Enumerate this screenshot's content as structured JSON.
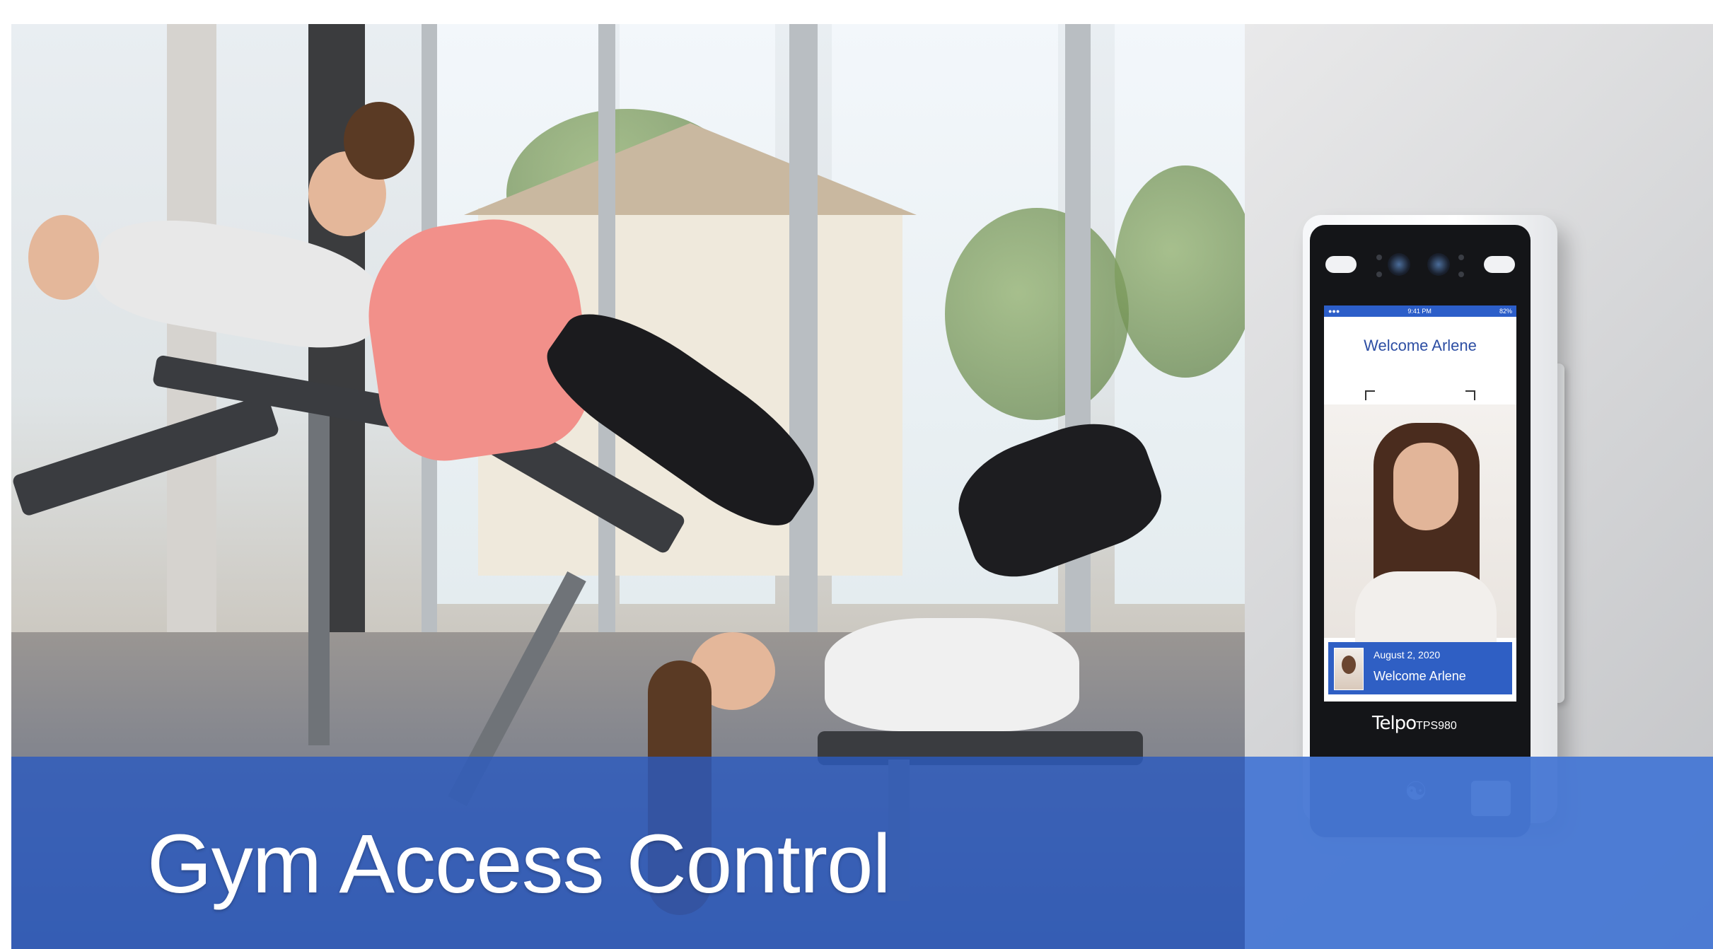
{
  "banner": {
    "headline": "Gym Access Control",
    "band_color": "#2c5abe"
  },
  "device": {
    "status_time": "9:41 PM",
    "status_battery": "82%",
    "welcome_top": "Welcome Arlene",
    "date": "August 2, 2020",
    "welcome_bottom": "Welcome Arlene",
    "brand": "Telpo",
    "model": "TPS980",
    "nfc_icon": "nfc-icon",
    "accent_color": "#2f5fc4"
  }
}
